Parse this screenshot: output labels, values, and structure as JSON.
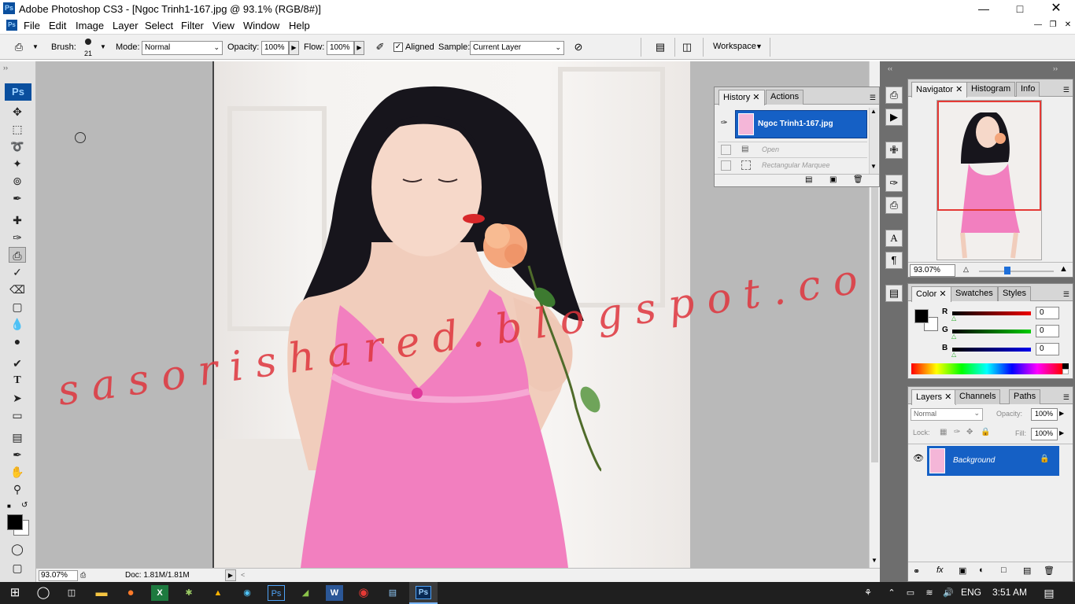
{
  "app": {
    "title": "Adobe Photoshop CS3 - [Ngoc Trinh1-167.jpg @ 93.1% (RGB/8#)]",
    "logo": "Ps",
    "window_controls": [
      "minimize-icon",
      "maximize-icon",
      "close-icon"
    ],
    "mdi_controls": [
      "minimize-icon",
      "restore-icon",
      "close-icon"
    ]
  },
  "menu": [
    "File",
    "Edit",
    "Image",
    "Layer",
    "Select",
    "Filter",
    "View",
    "Window",
    "Help"
  ],
  "options": {
    "brush_label": "Brush:",
    "brush_size": "21",
    "mode_label": "Mode:",
    "mode_value": "Normal",
    "opacity_label": "Opacity:",
    "opacity_value": "100%",
    "flow_label": "Flow:",
    "flow_value": "100%",
    "aligned_label": "Aligned",
    "aligned_checked": true,
    "sample_label": "Sample:",
    "sample_value": "Current Layer",
    "workspace_label": "Workspace"
  },
  "canvas": {
    "watermark": "sasorishared.blogspot.com",
    "watermark_color": "#e0343c"
  },
  "history": {
    "tabs": [
      "History",
      "Actions"
    ],
    "snapshot": "Ngoc Trinh1-167.jpg",
    "items": [
      "Open",
      "Rectangular Marquee"
    ]
  },
  "navigator": {
    "tabs": [
      "Navigator",
      "Histogram",
      "Info"
    ],
    "zoom": "93.07%",
    "view_box_color": "#e53935"
  },
  "color": {
    "tabs": [
      "Color",
      "Swatches",
      "Styles"
    ],
    "channels": [
      {
        "label": "R",
        "value": "0",
        "color": "#d22"
      },
      {
        "label": "G",
        "value": "0",
        "color": "#2b2"
      },
      {
        "label": "B",
        "value": "0",
        "color": "#22c"
      }
    ]
  },
  "layers": {
    "tabs": [
      "Layers",
      "Channels",
      "Paths"
    ],
    "blend": "Normal",
    "opacity_label": "Opacity:",
    "opacity_value": "100%",
    "lock_label": "Lock:",
    "fill_label": "Fill:",
    "fill_value": "100%",
    "layer_name": "Background"
  },
  "status": {
    "zoom": "93.07%",
    "doc": "Doc: 1.81M/1.81M"
  },
  "taskbar": {
    "lang": "ENG",
    "time": "3:51 AM"
  }
}
